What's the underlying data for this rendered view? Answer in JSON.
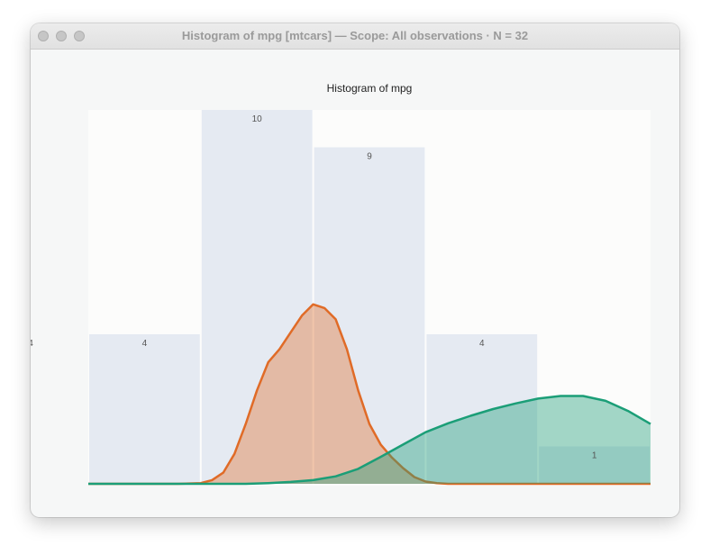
{
  "window": {
    "title": "Histogram of mpg [mtcars] — Scope: All observations · N = 32"
  },
  "chart_data": {
    "type": "bar",
    "title": "Histogram of mpg",
    "xlabel": "",
    "ylabel": "",
    "bins": [
      10,
      15,
      20,
      25,
      30,
      35
    ],
    "values": [
      4,
      10,
      9,
      4,
      1,
      4
    ],
    "ylim": [
      0,
      10
    ],
    "grid": false,
    "density_overlays": [
      {
        "color": "#e06b27",
        "x": [
          10,
          14,
          15,
          15.5,
          16,
          16.5,
          17,
          17.5,
          18,
          18.5,
          19,
          19.5,
          20,
          20.5,
          21,
          21.5,
          22,
          22.5,
          23,
          23.5,
          24,
          24.5,
          25,
          25.5,
          26,
          27,
          30,
          35
        ],
        "y": [
          0,
          0,
          0.02,
          0.1,
          0.3,
          0.8,
          1.6,
          2.5,
          3.25,
          3.6,
          4.05,
          4.5,
          4.8,
          4.7,
          4.4,
          3.6,
          2.5,
          1.6,
          1.05,
          0.7,
          0.42,
          0.18,
          0.06,
          0.02,
          0,
          0,
          0,
          0
        ]
      },
      {
        "color": "#1b9e77",
        "x": [
          10,
          15,
          17,
          18,
          19,
          20,
          21,
          22,
          23,
          24,
          25,
          26,
          27,
          28,
          29,
          30,
          31,
          32,
          33,
          34,
          35
        ],
        "y": [
          0,
          0,
          0,
          0.02,
          0.05,
          0.1,
          0.2,
          0.4,
          0.72,
          1.05,
          1.38,
          1.62,
          1.82,
          2.0,
          2.15,
          2.28,
          2.35,
          2.35,
          2.22,
          1.95,
          1.6
        ]
      }
    ]
  }
}
